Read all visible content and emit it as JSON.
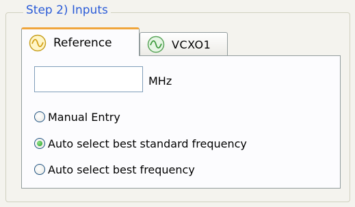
{
  "groupbox": {
    "title": "Step 2) Inputs"
  },
  "tabs": [
    {
      "label": "Reference",
      "icon": "sine-wave-icon",
      "icon_color": "#f0c020",
      "selected": true
    },
    {
      "label": "VCXO1",
      "icon": "sine-wave-icon",
      "icon_color": "#4caf50",
      "selected": false
    }
  ],
  "frequency": {
    "value": "",
    "unit": "MHz"
  },
  "options": [
    {
      "label": "Manual Entry",
      "checked": false
    },
    {
      "label": "Auto select best standard frequency",
      "checked": true
    },
    {
      "label": "Auto select best frequency",
      "checked": false
    }
  ],
  "colors": {
    "title": "#2a5bd7",
    "tab_highlight": "#f0a53a",
    "border": "#919b9c"
  }
}
